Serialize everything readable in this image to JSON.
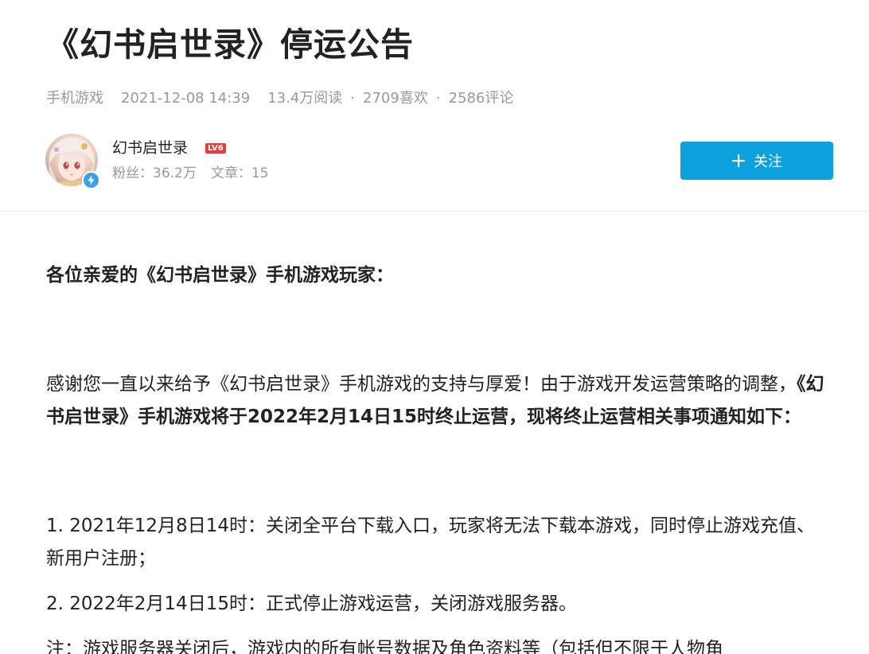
{
  "article": {
    "title": "《幻书启世录》停运公告",
    "category": "手机游戏",
    "datetime": "2021-12-08 14:39",
    "reads": "13.4万阅读",
    "likes": "2709喜欢",
    "comments": "2586评论",
    "separator": "·"
  },
  "author": {
    "name": "幻书启世录",
    "level_badge": "LV6",
    "fans": "粉丝：36.2万",
    "articles": "文章：15",
    "follow_label": "关注",
    "verified_icon": "lightning-icon"
  },
  "colors": {
    "accent": "#0ca0dd",
    "level_badge": "#e83b3b",
    "verified": "#3aa0e8",
    "meta_text": "#999999",
    "body_text": "#222222"
  },
  "body": {
    "greeting": "各位亲爱的《幻书启世录》手机游戏玩家：",
    "para2_normal": "感谢您一直以来给予《幻书启世录》手机游戏的支持与厚爱！由于游戏开发运营策略的调整，",
    "para2_bold": "《幻书启世录》手机游戏将于2022年2月14日15时终止运营，现将终止运营相关事项通知如下：",
    "item1": "1. 2021年12月8日14时：关闭全平台下载入口，玩家将无法下载本游戏，同时停止游戏充值、新用户注册；",
    "item2": "2. 2022年2月14日15时：正式停止游戏运营，关闭游戏服务器。",
    "note": "注：游戏服务器关闭后，游戏内的所有帐号数据及角色资料等（包括但不限于人物角"
  }
}
